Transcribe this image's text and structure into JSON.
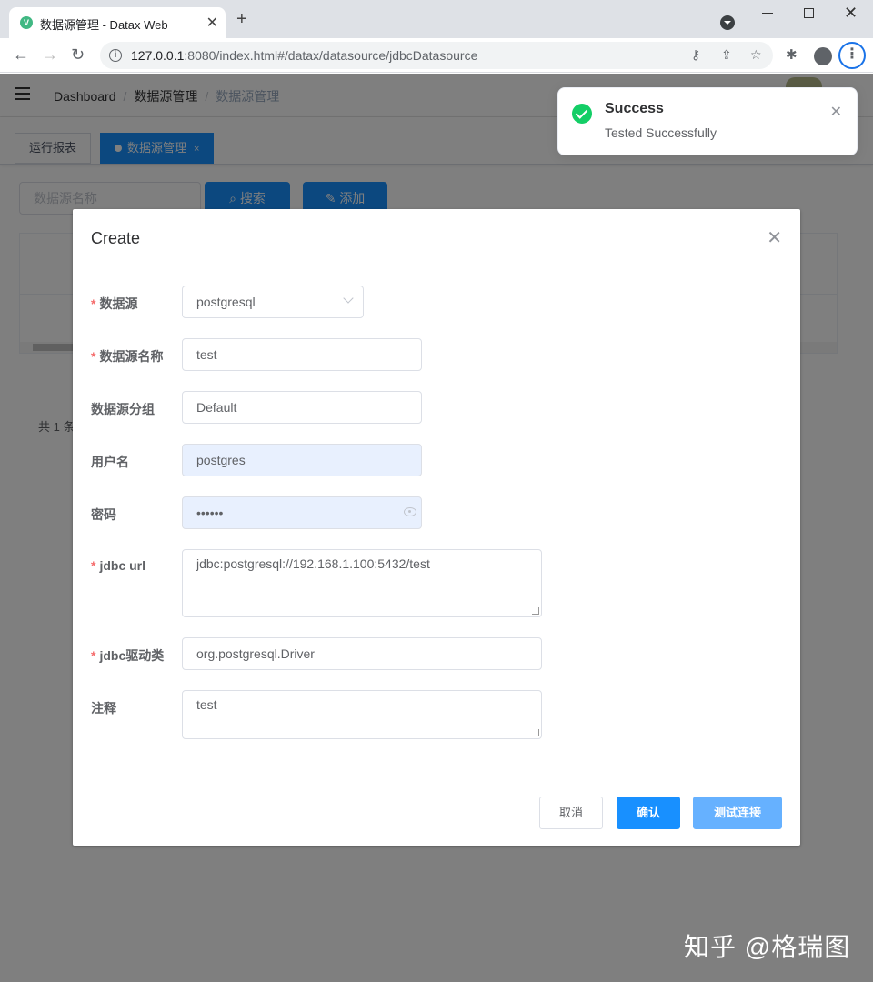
{
  "browser": {
    "tab_title": "数据源管理 - Datax Web",
    "tab_favicon": "V",
    "url_host": "127.0.0.1",
    "url_rest": ":8080/index.html#/datax/datasource/jdbcDatasource"
  },
  "app": {
    "breadcrumb": [
      "Dashboard",
      "数据源管理",
      "数据源管理"
    ],
    "tags": [
      {
        "label": "运行报表",
        "active": false
      },
      {
        "label": "数据源管理",
        "active": true
      }
    ],
    "tag_close": "×",
    "filter_placeholder": "数据源名称",
    "search_label": "搜索",
    "add_label": "添加",
    "total_text": "共 1 条"
  },
  "dialog": {
    "title": "Create",
    "fields": {
      "datasource": {
        "label": "数据源",
        "value": "postgresql",
        "required": true
      },
      "name": {
        "label": "数据源名称",
        "value": "test",
        "required": true
      },
      "group": {
        "label": "数据源分组",
        "value": "Default",
        "required": false
      },
      "username": {
        "label": "用户名",
        "value": "postgres",
        "required": false
      },
      "password": {
        "label": "密码",
        "value": "••••••",
        "required": false
      },
      "jdbc_url": {
        "label": "jdbc url",
        "value": "jdbc:postgresql://192.168.1.100:5432/test",
        "required": true
      },
      "driver": {
        "label": "jdbc驱动类",
        "value": "org.postgresql.Driver",
        "required": true
      },
      "comment": {
        "label": "注释",
        "value": "test",
        "required": false
      }
    },
    "cancel_label": "取消",
    "confirm_label": "确认",
    "test_label": "测试连接"
  },
  "notification": {
    "title": "Success",
    "message": "Tested Successfully"
  },
  "watermark": "知乎 @格瑞图",
  "colors": {
    "primary": "#1890ff",
    "success": "#13ce66",
    "required": "#f56c6c"
  }
}
